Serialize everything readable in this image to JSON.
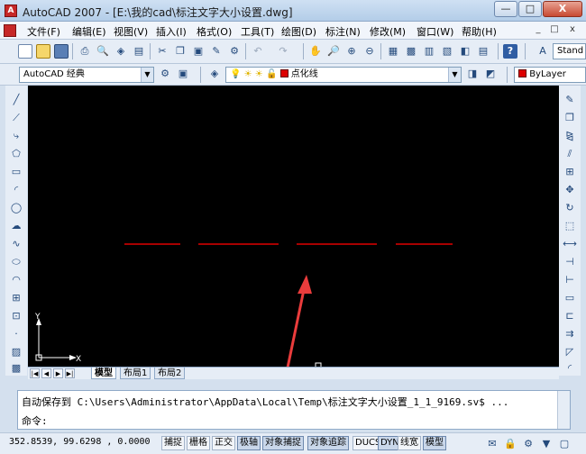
{
  "window": {
    "app_icon": "autocad-logo-icon",
    "title": "AutoCAD 2007 - [E:\\我的cad\\标注文字大小设置.dwg]",
    "minimize": "—",
    "maximize": "□",
    "close": "X"
  },
  "menu": {
    "items": [
      "文件(F)",
      "编辑(E)",
      "视图(V)",
      "插入(I)",
      "格式(O)",
      "工具(T)",
      "绘图(D)",
      "标注(N)",
      "修改(M)",
      "窗口(W)",
      "帮助(H)"
    ],
    "doc_controls": [
      "_",
      "□",
      "x"
    ]
  },
  "toolbar": {
    "text_style_combo": "Stand"
  },
  "toolbar2": {
    "workspace_combo": "AutoCAD 经典",
    "layer_combo": "点化线",
    "color_combo": "ByLayer"
  },
  "canvas": {
    "background": "#000000",
    "dash_color": "#e00000",
    "arrow_color": "#ea3c3c",
    "ucs_x": "X",
    "ucs_y": "Y"
  },
  "tabs": {
    "items": [
      "模型",
      "布局1",
      "布局2"
    ],
    "active": "模型"
  },
  "command": {
    "history_line": "自动保存到 C:\\Users\\Administrator\\AppData\\Local\\Temp\\标注文字大小设置_1_1_9169.sv$ ...",
    "prompt": "命令:"
  },
  "status": {
    "coords": "352.8539, 99.6298 , 0.0000",
    "buttons": [
      "捕捉",
      "栅格",
      "正交",
      "极轴",
      "对象捕捉",
      "对象追踪",
      "DUCS",
      "DYN",
      "线宽",
      "模型"
    ]
  }
}
